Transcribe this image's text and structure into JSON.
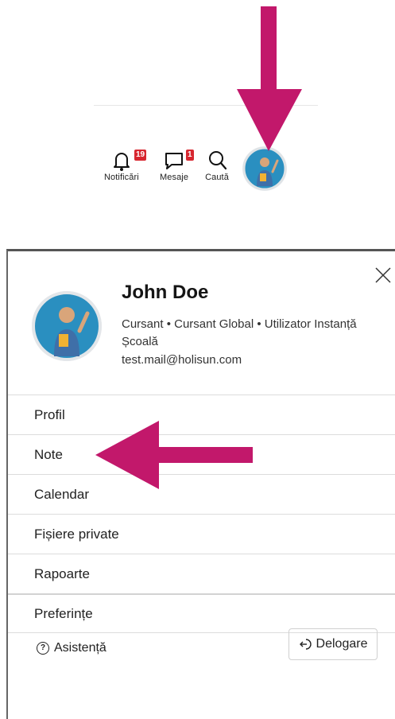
{
  "navbar": {
    "notifications": {
      "label": "Notificări",
      "badge": "19",
      "icon": "bell-icon"
    },
    "messages": {
      "label": "Mesaje",
      "badge": "1",
      "icon": "chat-icon"
    },
    "search": {
      "label": "Caută",
      "icon": "search-icon"
    },
    "avatar": "user-avatar"
  },
  "user": {
    "name": "John Doe",
    "roles": "Cursant • Cursant Global • Utilizator Instanță Școală",
    "email": "test.mail@holisun.com"
  },
  "menu": {
    "items": [
      {
        "label": "Profil"
      },
      {
        "label": "Note"
      },
      {
        "label": "Calendar"
      },
      {
        "label": "Fișiere private"
      },
      {
        "label": "Rapoarte"
      },
      {
        "label": "Preferințe"
      }
    ]
  },
  "footer": {
    "help_label": "Asistență",
    "logout_label": "Delogare"
  },
  "colors": {
    "arrow": "#c2186b",
    "badge": "#d7262f",
    "avatar_bg": "#2a8fc0"
  }
}
